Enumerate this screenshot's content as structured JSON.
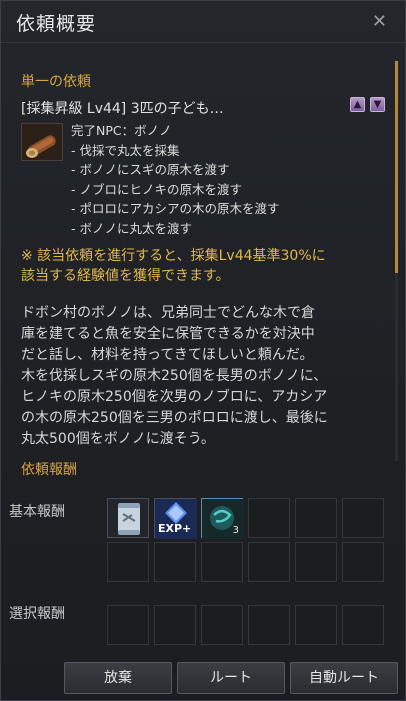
{
  "window": {
    "title": "依頼概要"
  },
  "quest": {
    "section_label": "単一の依頼",
    "name": "[採集昇級 Lv44] 3匹の子ども…",
    "complete_npc": "完了NPC：ボノノ",
    "objectives": [
      "- 伐採で丸太を採集",
      "- ボノノにスギの原木を渡す",
      "- ノブロにヒノキの原木を渡す",
      "- ポロロにアカシアの木の原木を渡す",
      "- ボノノに丸太を渡す"
    ],
    "notice": [
      "※ 該当依頼を進行すると、採集Lv44基準30%に",
      "該当する経験値を獲得できます。"
    ],
    "description": [
      "ドボン村のボノノは、兄弟同士でどんな木で倉",
      "庫を建てると魚を安全に保管できるかを対決中",
      "だと話し、材料を持ってきてほしいと頼んだ。",
      "木を伐採しスギの原木250個を長男のボノノに、",
      "ヒノキの原木250個を次男のノブロに、アカシア",
      "の木の原木250個を三男のポロロに渡し、最後に",
      "丸太500個をボノノに渡そう。"
    ]
  },
  "rewards": {
    "section_label": "依頼報酬",
    "basic_label": "基本報酬",
    "select_label": "選択報酬",
    "basic_items": [
      {
        "icon": "scroll-icon"
      },
      {
        "icon": "exp-crystal-icon",
        "label": "EXP+"
      },
      {
        "icon": "teal-orb-icon",
        "count": "3"
      }
    ]
  },
  "buttons": {
    "abandon": "放棄",
    "route": "ルート",
    "auto_route": "自動ルート"
  },
  "colors": {
    "accent": "#d8a441",
    "notice": "#e0b84a",
    "scroll_thumb": "#b7883c"
  }
}
